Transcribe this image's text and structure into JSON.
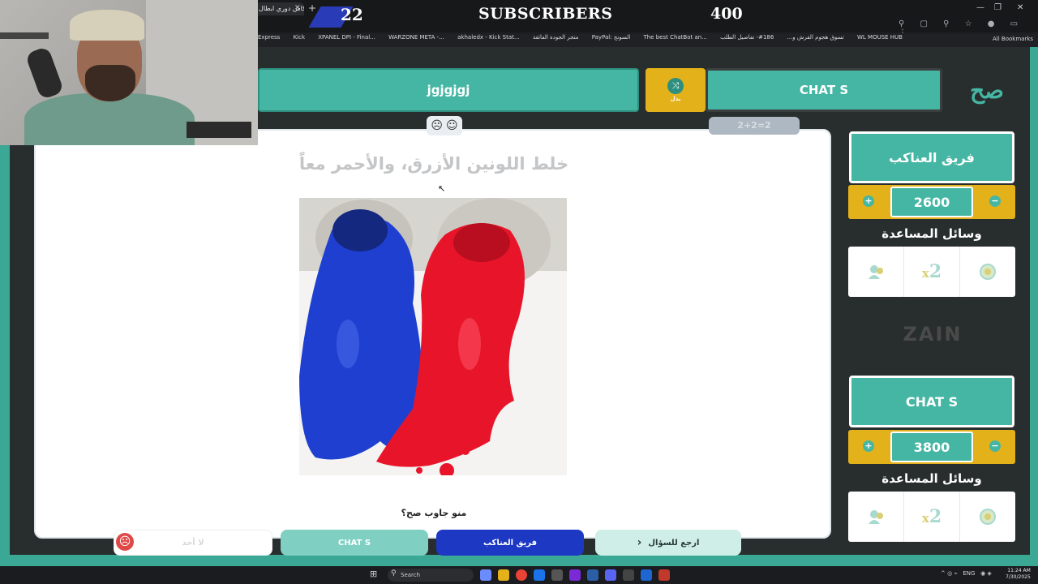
{
  "browser": {
    "tab_title": "كاس دوري ابطال",
    "tab_close": "✕",
    "tab_new": "+",
    "window_controls": [
      "—",
      "❐",
      "✕"
    ],
    "toolbar_icons": "⚲ ▢ ⚲ ☆ ● ▭ ⋮",
    "bookmarks": [
      "Express",
      "Kick",
      "XPANEL DPI - Final...",
      "WARZONE META -...",
      "akhaledx - Kick Stat...",
      "متجر الجودة الفائقة",
      "PayPal: السونج",
      "The best ChatBot an...",
      "تسوق هجوم القرش و...",
      "186#- تفاصيل الطلب",
      "WL MOUSE HUB"
    ],
    "all_bookmarks": "All Bookmarks"
  },
  "stream_overlay": {
    "left_count": "22",
    "label": "SUBSCRIBERS",
    "right_count": "400"
  },
  "game": {
    "top_team_a": "jgjgjgj",
    "swap_icon": "⤨",
    "swap_label": "بدل",
    "top_team_b": "CHAT S",
    "logo_text": "صح",
    "hint_pill": "2+2=2",
    "emoji_sad": "☹",
    "emoji_happy": "☺",
    "question": "خلط اللونين الأزرق، والأحمر معاً",
    "who_answered": "منو جاوب صح؟",
    "cursor_glyph": "↖"
  },
  "teams": [
    {
      "name": "فريق العناكب",
      "score": "2600",
      "plus": "+",
      "minus": "−",
      "help_label": "وسائل المساعدة"
    },
    {
      "name": "CHAT S",
      "score": "3800",
      "plus": "+",
      "minus": "−",
      "help_label": "وسائل المساعدة"
    }
  ],
  "help_icons": [
    "call-icon",
    "x2-icon",
    "hole-icon"
  ],
  "x2_text": "x",
  "x2_num": "2",
  "sponsor": "ZAIN",
  "bottom": {
    "none_label": "لا أحد",
    "sad_face": "☹",
    "chat_label": "CHAT S",
    "anakeb_label": "فريق العناكب",
    "back_label": "ارجع للسؤال",
    "back_arrow": "‹"
  },
  "taskbar": {
    "search_placeholder": "Search",
    "lang": "ENG",
    "time": "11:24 AM",
    "date": "7/30/2025"
  },
  "colors": {
    "teal": "#45b6a3",
    "gold": "#e3b11a",
    "blue_button": "#1d39c4",
    "dark_frame": "#282d2d"
  }
}
